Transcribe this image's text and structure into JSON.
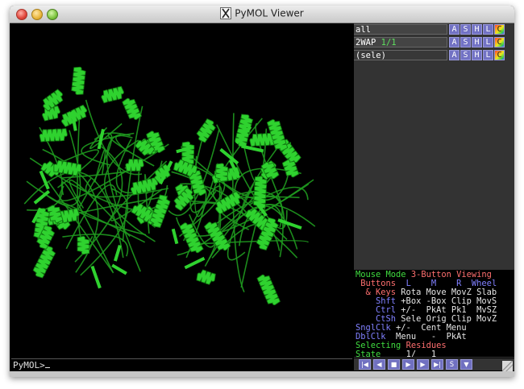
{
  "window": {
    "title": "PyMOL Viewer",
    "icon": "x11-icon"
  },
  "objects": [
    {
      "name": "all",
      "extra": "",
      "kind": "all"
    },
    {
      "name": "2WAP",
      "extra": "1/1",
      "kind": "object"
    },
    {
      "name": "(sele)",
      "extra": "",
      "kind": "selection"
    }
  ],
  "action_buttons": [
    "A",
    "S",
    "H",
    "L",
    "C"
  ],
  "mouse_panel": {
    "line1": {
      "a": "Mouse Mode ",
      "b": "3-Button Viewing"
    },
    "line2": {
      "a": " Buttons  ",
      "b": "L",
      "c": "    M    ",
      "d": "R",
      "e": "  Wheel"
    },
    "rows": [
      {
        "mod": "  & Keys",
        "vals": " Rota Move MovZ Slab"
      },
      {
        "mod": "    Shft",
        "vals": " +Box -Box Clip MovS"
      },
      {
        "mod": "    Ctrl",
        "vals": " +/-  PkAt Pk1  MvSZ"
      },
      {
        "mod": "    CtSh",
        "vals": " Sele Orig Clip MovZ"
      },
      {
        "mod": "SnglClk",
        "vals": " +/-  Cent Menu"
      },
      {
        "mod": "DblClk",
        "vals": "  Menu   -  PkAt"
      }
    ],
    "selecting": {
      "a": "Selecting ",
      "b": "Residues"
    },
    "state": {
      "label": "State",
      "current": "1/",
      "total": "1"
    }
  },
  "command_line": {
    "prompt": "PyMOL>"
  },
  "transport": [
    "|◀",
    "◀",
    "■",
    "▶",
    "▶",
    "▶|",
    "S",
    "▼"
  ],
  "colors": {
    "protein": "#2fd22f",
    "background": "#000000",
    "panel": "#333333",
    "accent_button": "#7070c0"
  }
}
